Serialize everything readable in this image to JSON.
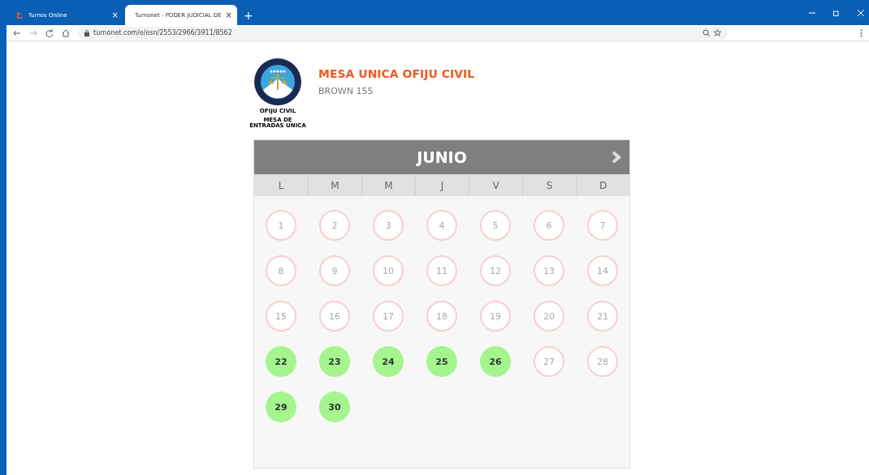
{
  "browser": {
    "tabs": [
      {
        "label": "Turnos Online",
        "selected": false,
        "close": "×"
      },
      {
        "label": "Turnonet - PODER JUDICIAL DE",
        "selected": true,
        "close": "×"
      }
    ],
    "new_tab": "+",
    "url": "turnonet.com/e/esn/2553/2966/3911/8562"
  },
  "header": {
    "logo_caption": "OFIJU CIVIL",
    "logo_subcaption": "MESA DE ENTRADAS UNICA",
    "title": "MESA UNICA OFIJU CIVIL",
    "address": "BROWN 155"
  },
  "calendar": {
    "month": "JUNIO",
    "weekdays": [
      "L",
      "M",
      "M",
      "J",
      "V",
      "S",
      "D"
    ],
    "days": [
      {
        "label": "1",
        "available": false
      },
      {
        "label": "2",
        "available": false
      },
      {
        "label": "3",
        "available": false
      },
      {
        "label": "4",
        "available": false
      },
      {
        "label": "5",
        "available": false
      },
      {
        "label": "6",
        "available": false
      },
      {
        "label": "7",
        "available": false
      },
      {
        "label": "8",
        "available": false
      },
      {
        "label": "9",
        "available": false
      },
      {
        "label": "10",
        "available": false
      },
      {
        "label": "11",
        "available": false
      },
      {
        "label": "12",
        "available": false
      },
      {
        "label": "13",
        "available": false
      },
      {
        "label": "14",
        "available": false
      },
      {
        "label": "15",
        "available": false
      },
      {
        "label": "16",
        "available": false
      },
      {
        "label": "17",
        "available": false
      },
      {
        "label": "18",
        "available": false
      },
      {
        "label": "19",
        "available": false
      },
      {
        "label": "20",
        "available": false
      },
      {
        "label": "21",
        "available": false
      },
      {
        "label": "22",
        "available": true
      },
      {
        "label": "23",
        "available": true
      },
      {
        "label": "24",
        "available": true
      },
      {
        "label": "25",
        "available": true
      },
      {
        "label": "26",
        "available": true
      },
      {
        "label": "27",
        "available": false
      },
      {
        "label": "28",
        "available": false
      },
      {
        "label": "29",
        "available": true
      },
      {
        "label": "30",
        "available": true
      }
    ]
  }
}
